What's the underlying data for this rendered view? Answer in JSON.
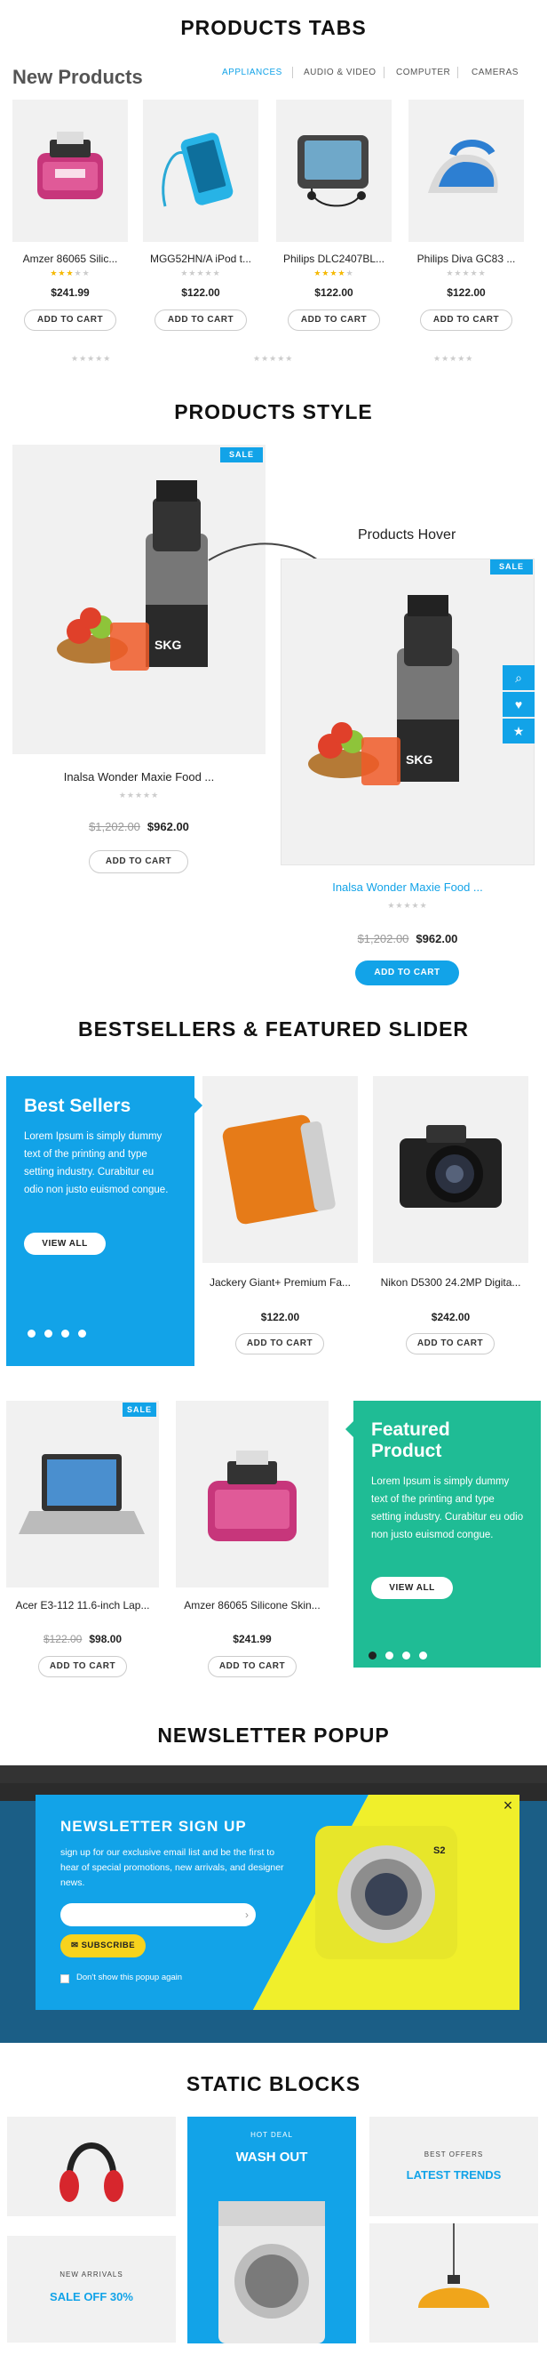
{
  "sections": {
    "tabs_title": "PRODUCTS TABS",
    "style_title": "PRODUCTS STYLE",
    "slider_title": "BESTSELLERS & FEATURED SLIDER",
    "newsletter_title": "NEWSLETTER POPUP",
    "static_title": "STATIC BLOCKS"
  },
  "tabs_block": {
    "heading": "New Products",
    "tabs": [
      "APPLIANCES",
      "AUDIO & VIDEO",
      "COMPUTER",
      "CAMERAS"
    ],
    "products": [
      {
        "name": "Amzer 86065 Silic...",
        "price": "$241.99",
        "cart": "ADD TO CART",
        "stars": "★★★★★",
        "icon": "speaker-dock-image"
      },
      {
        "name": "MGG52HN/A iPod t...",
        "price": "$122.00",
        "cart": "ADD TO CART",
        "stars": "★★★★★",
        "icon": "ipod-image"
      },
      {
        "name": "Philips DLC2407BL...",
        "price": "$122.00",
        "cart": "ADD TO CART",
        "stars": "★★★★★",
        "icon": "portable-player-image"
      },
      {
        "name": "Philips Diva GC83 ...",
        "price": "$122.00",
        "cart": "ADD TO CART",
        "stars": "★★★★★",
        "icon": "iron-image"
      }
    ],
    "extra_stars": "★★★★★"
  },
  "style_block": {
    "hover_label": "Products Hover",
    "sale": "SALE",
    "normal": {
      "name": "Inalsa Wonder Maxie Food ...",
      "old_price": "$1,202.00",
      "price": "$962.00",
      "cart": "ADD TO CART",
      "stars": "★★★★★"
    },
    "hover": {
      "name": "Inalsa Wonder Maxie Food ...",
      "old_price": "$1,202.00",
      "price": "$962.00",
      "cart": "ADD TO CART",
      "stars": "★★★★★"
    }
  },
  "bestsellers": {
    "title": "Best Sellers",
    "text": "Lorem Ipsum is simply dummy text of the printing and type setting industry. Curabitur eu odio non justo euismod congue.",
    "button": "VIEW ALL",
    "accent": "#12a3e8",
    "products": [
      {
        "name": "Jackery Giant+ Premium Fa...",
        "price": "$122.00",
        "cart": "ADD TO CART"
      },
      {
        "name": "Nikon D5300 24.2MP Digita...",
        "price": "$242.00",
        "cart": "ADD TO CART"
      }
    ]
  },
  "featured": {
    "title_line1": "Featured",
    "title_line2": "Product",
    "text": "Lorem Ipsum is simply dummy text of the printing and type setting industry. Curabitur eu odio non justo euismod congue.",
    "button": "VIEW ALL",
    "accent": "#1fbc95",
    "sale": "SALE",
    "products": [
      {
        "name": "Acer E3-112 11.6-inch Lap...",
        "old_price": "$122.00",
        "price": "$98.00",
        "cart": "ADD TO CART"
      },
      {
        "name": "Amzer 86065 Silicone Skin...",
        "price": "$241.99",
        "cart": "ADD TO CART"
      }
    ]
  },
  "newsletter": {
    "title": "NEWSLETTER SIGN UP",
    "text": "sign up for our exclusive email list and be the first to hear of special promotions, new arrivals, and designer news.",
    "input_placeholder": "",
    "button": "SUBSCRIBE",
    "checkbox_label": "Don't show this popup again",
    "close": "×"
  },
  "static_blocks": {
    "hot_deal_small": "HOT DEAL",
    "hot_deal_big": "WASH OUT",
    "best_offers_small": "BEST OFFERS",
    "best_offers_big": "LATEST TRENDS",
    "new_arrivals_small": "NEW ARRIVALS",
    "new_arrivals_big": "SALE OFF 30%"
  }
}
